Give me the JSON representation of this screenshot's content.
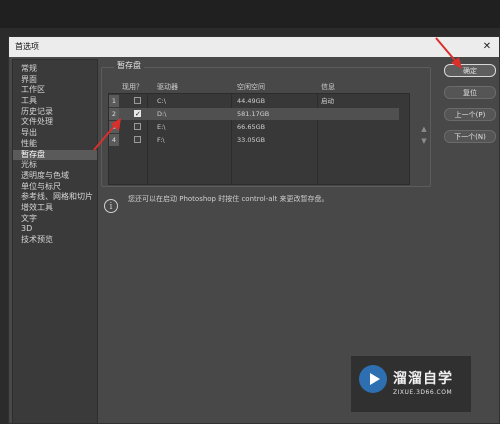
{
  "dialog": {
    "title": "首选项",
    "close_glyph": "✕"
  },
  "sidebar": {
    "items": [
      {
        "label": "常规"
      },
      {
        "label": "界面"
      },
      {
        "label": "工作区"
      },
      {
        "label": "工具"
      },
      {
        "label": "历史记录"
      },
      {
        "label": "文件处理"
      },
      {
        "label": "导出"
      },
      {
        "label": "性能"
      },
      {
        "label": "暂存盘",
        "active": true
      },
      {
        "label": "光标"
      },
      {
        "label": "透明度与色域"
      },
      {
        "label": "单位与标尺"
      },
      {
        "label": "参考线、网格和切片"
      },
      {
        "label": "增效工具"
      },
      {
        "label": "文字"
      },
      {
        "label": "3D"
      },
      {
        "label": "技术预览"
      }
    ]
  },
  "scratch": {
    "title": "暂存盘",
    "columns": {
      "active": "现用？",
      "drive": "驱动器",
      "free": "空闲空间",
      "info": "信息"
    },
    "rows": [
      {
        "num": "1",
        "checked": false,
        "drive": "C:\\",
        "free": "44.49GB",
        "info": "启动"
      },
      {
        "num": "2",
        "checked": true,
        "drive": "D:\\",
        "free": "581.17GB",
        "info": ""
      },
      {
        "num": "3",
        "checked": false,
        "drive": "E:\\",
        "free": "66.65GB",
        "info": ""
      },
      {
        "num": "4",
        "checked": false,
        "drive": "F:\\",
        "free": "33.05GB",
        "info": ""
      }
    ],
    "up_arrow": "▲",
    "down_arrow": "▼"
  },
  "note": {
    "icon": "info-icon",
    "glyph": "i",
    "text": "您还可以在启动 Photoshop 时按住 control-alt 来更改暂存盘。"
  },
  "buttons": {
    "ok": "确定",
    "reset": "复位",
    "prev": "上一个(P)",
    "next": "下一个(N)"
  },
  "watermark": {
    "name": "溜溜自学",
    "url": "ZIXUE.3D66.COM"
  },
  "colors": {
    "annotation_arrow": "#d9302c",
    "dialog_bg": "#484848",
    "titlebar": "#ececec"
  }
}
